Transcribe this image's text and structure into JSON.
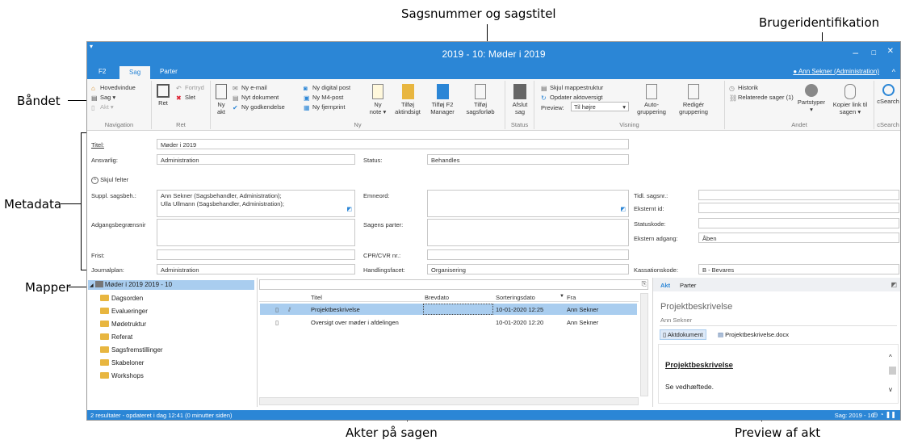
{
  "annotations": {
    "case": "Sagsnummer og sagstitel",
    "user": "Brugeridentifikation",
    "ribbon": "Båndet",
    "metadata": "Metadata",
    "folders": "Mapper",
    "docs": "Akter på sagen",
    "preview": "Preview af akt"
  },
  "window": {
    "title": "2019 - 10: Møder i 2019",
    "user": "Ann Sekner (Administration)",
    "minimize": "–",
    "maximize": "□",
    "close": "✕",
    "collapse": "^"
  },
  "ribbon_tabs": [
    "F2",
    "Sag",
    "Parter"
  ],
  "ribbon": {
    "navigation": {
      "label": "Navigation",
      "items": [
        "Hovedvindue",
        "Sag ▾",
        "Akt ▾"
      ]
    },
    "ret": {
      "label": "Ret",
      "big": "Ret",
      "items": [
        "Fortryd",
        "Slet"
      ]
    },
    "ny": {
      "label": "Ny",
      "ny_akt": "Ny akt",
      "col1": [
        "Ny e-mail",
        "Nyt dokument",
        "Ny godkendelse"
      ],
      "col2": [
        "Ny digital post",
        "Ny M4-post",
        "Ny fjernprint"
      ],
      "ny_note": "Ny note ▾",
      "aktindsigt": "Tilføj aktindsigt",
      "f2manager": "Tilføj F2 Manager",
      "sagsforloeb": "Tilføj sagsforløb"
    },
    "status": {
      "label": "Status",
      "afslut": "Afslut sag"
    },
    "visning": {
      "label": "Visning",
      "items": [
        "Skjul mappestruktur",
        "Opdater aktoversigt"
      ],
      "preview_label": "Preview:",
      "preview_value": "Til højre",
      "autogruppering": "Auto-gruppering",
      "rediger": "Redigér gruppering"
    },
    "andet": {
      "label": "Andet",
      "historik": "Historik",
      "relaterede": "Relaterede sager (1)",
      "partstyper": "Partstyper ▾",
      "kopier": "Kopier link til sagen ▾"
    },
    "csearch": {
      "label": "cSearch",
      "btn": "cSearch"
    }
  },
  "meta": {
    "titel_label": "Titel:",
    "titel": "Møder i 2019",
    "ansvarlig_label": "Ansvarlig:",
    "ansvarlig": "Administration",
    "status_label": "Status:",
    "status": "Behandles",
    "skjul": "Skjul felter",
    "suppl_label": "Suppl. sagsbeh.:",
    "suppl1": "Ann Sekner (Sagsbehandler, Administration);",
    "suppl2": "Ulla Ullmann (Sagsbehandler, Administration);",
    "emneord_label": "Emneord:",
    "tidl_label": "Tidl. sagsnr.:",
    "eksternt_label": "Eksternt id:",
    "adgang_label": "Adgangsbegrænsnir",
    "parter_label": "Sagens parter:",
    "statuskode_label": "Statuskode:",
    "ekstern_label": "Ekstern adgang:",
    "ekstern": "Åben",
    "frist_label": "Frist:",
    "cpr_label": "CPR/CVR nr.:",
    "journal_label": "Journalplan:",
    "journal": "Administration",
    "facet_label": "Handlingsfacet:",
    "facet": "Organisering",
    "kassation_label": "Kassationskode:",
    "kassation": "B - Bevares"
  },
  "tree": {
    "root": "Møder i 2019 2019 - 10",
    "folders": [
      "Dagsorden",
      "Evalueringer",
      "Mødetruktur",
      "Referat",
      "Sagsfremstillinger",
      "Skabeloner",
      "Workshops"
    ]
  },
  "docs": {
    "columns": [
      "Titel",
      "Brevdato",
      "Sorteringsdato",
      "Fra"
    ],
    "rows": [
      {
        "title": "Projektbeskrivelse",
        "brevdato": "",
        "date": "10-01-2020 12:25",
        "from": "Ann Sekner"
      },
      {
        "title": "Oversigt over møder i afdelingen",
        "brevdato": "",
        "date": "10-01-2020 12:20",
        "from": "Ann Sekner"
      }
    ]
  },
  "preview": {
    "tabs": [
      "Akt",
      "Parter"
    ],
    "title": "Projektbeskrivelse",
    "author": "Ann Sekner",
    "aktdokument": "Aktdokument",
    "file": "Projektbeskrivelse.docx",
    "heading": "Projektbeskrivelse",
    "body": "Se vedhæftede."
  },
  "status": {
    "left": "2 resultater - opdateret i dag 12:41 (0 minutter siden)",
    "right": "Sag: 2019 - 10"
  },
  "colors": {
    "accent": "#2b86d6",
    "selection": "#a9cdef",
    "folder": "#e8b640"
  }
}
